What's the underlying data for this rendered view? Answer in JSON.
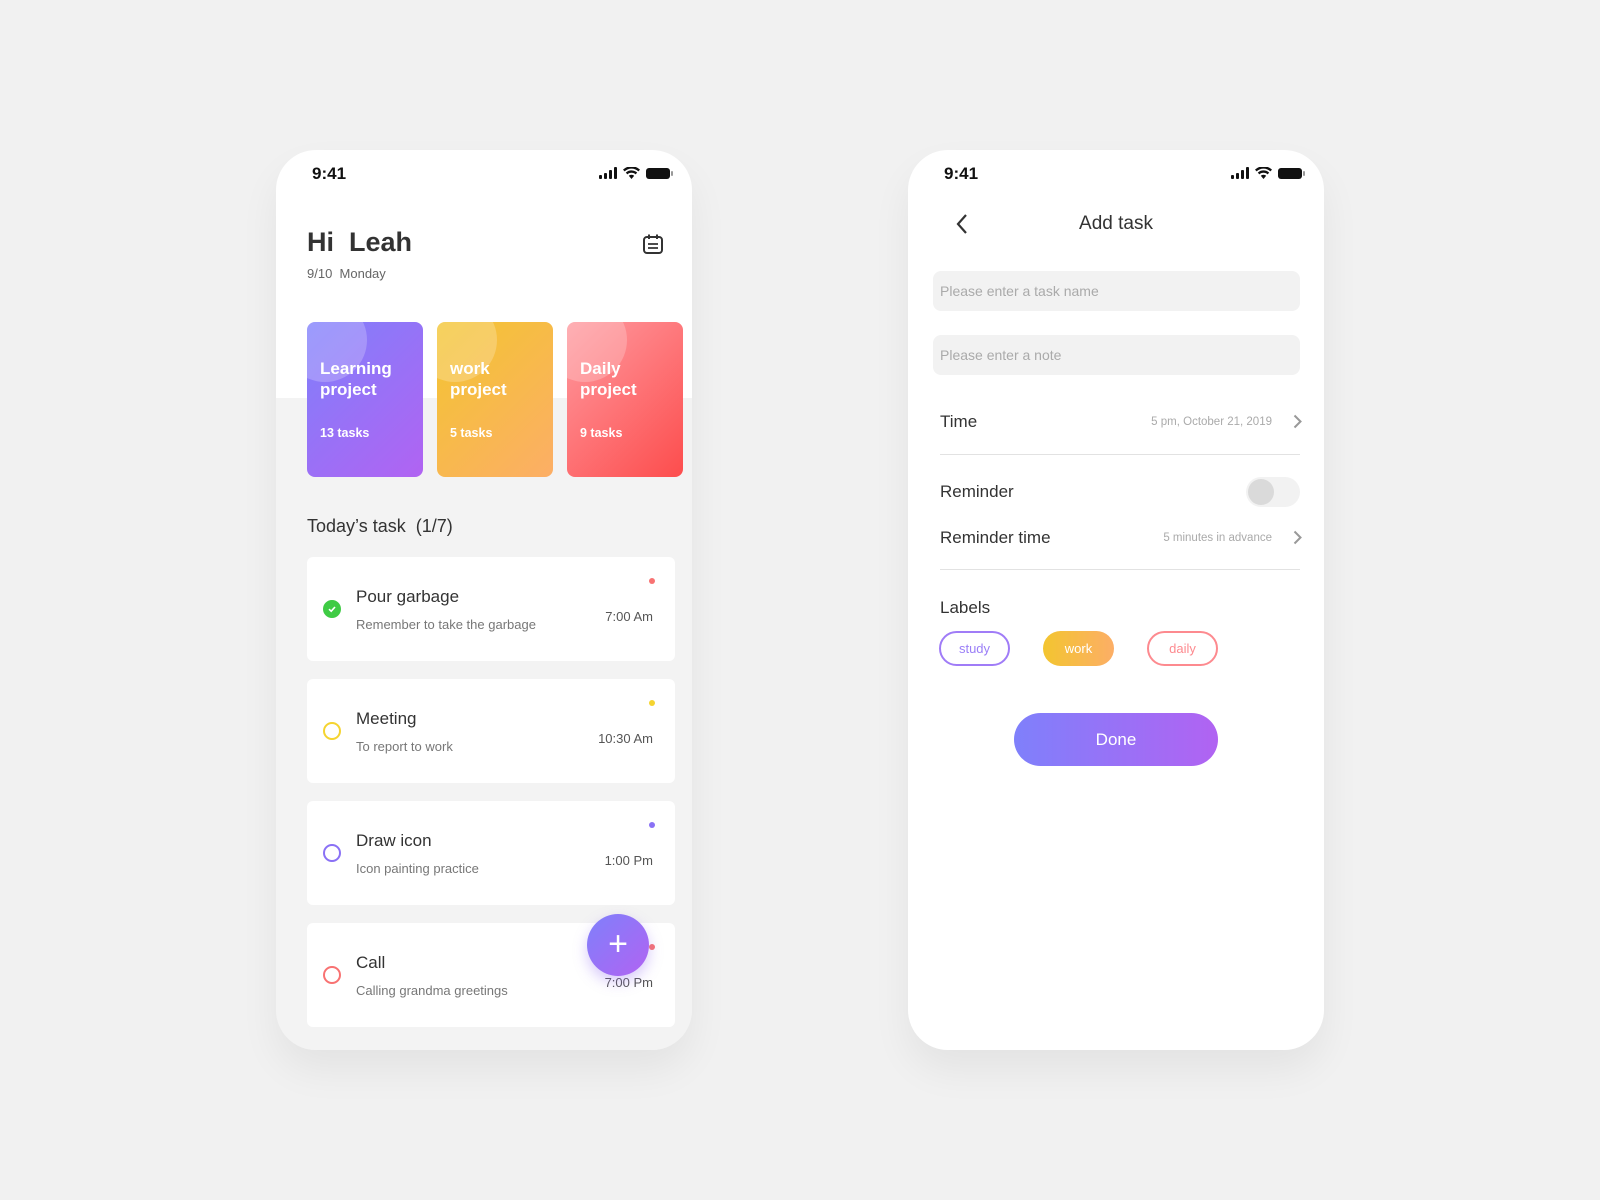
{
  "home": {
    "status_time": "9:41",
    "greeting": "Hi  Leah",
    "date": "9/10  Monday",
    "projects": [
      {
        "title": "Learning project",
        "count": "13 tasks",
        "gradient": [
          "#7f80fb",
          "#b163f2"
        ]
      },
      {
        "title": "work project",
        "count": "5 tasks",
        "gradient": [
          "#f3c530",
          "#fcae66"
        ]
      },
      {
        "title": "Daily project",
        "count": "9 tasks",
        "gradient": [
          "#fe9aa0",
          "#fd4d4d"
        ]
      }
    ],
    "section_title": "Today’s task  (1/7)",
    "tasks": [
      {
        "name": "Pour garbage",
        "note": "Remember to take the garbage",
        "time": "7:00 Am",
        "color": "#f87272",
        "check_color": "#3fcb44",
        "done": true
      },
      {
        "name": "Meeting",
        "note": "To report to work",
        "time": "10:30 Am",
        "color": "#f5d430",
        "done": false
      },
      {
        "name": "Draw icon",
        "note": "Icon painting practice",
        "time": "1:00 Pm",
        "color": "#8a71f5",
        "done": false
      },
      {
        "name": "Call",
        "note": "Calling grandma greetings",
        "time": "7:00 Pm",
        "color": "#f87272",
        "done": false
      }
    ],
    "fab_label": "+"
  },
  "add_task": {
    "status_time": "9:41",
    "title": "Add task",
    "task_name_placeholder": "Please enter a task name",
    "note_placeholder": "Please enter a note",
    "time_label": "Time",
    "time_value": "5 pm, October 21, 2019",
    "reminder_label": "Reminder",
    "reminder_on": false,
    "reminder_time_label": "Reminder time",
    "reminder_time_value": "5 minutes in advance",
    "labels_title": "Labels",
    "labels": [
      "study",
      "work",
      "daily"
    ],
    "done_label": "Done"
  }
}
